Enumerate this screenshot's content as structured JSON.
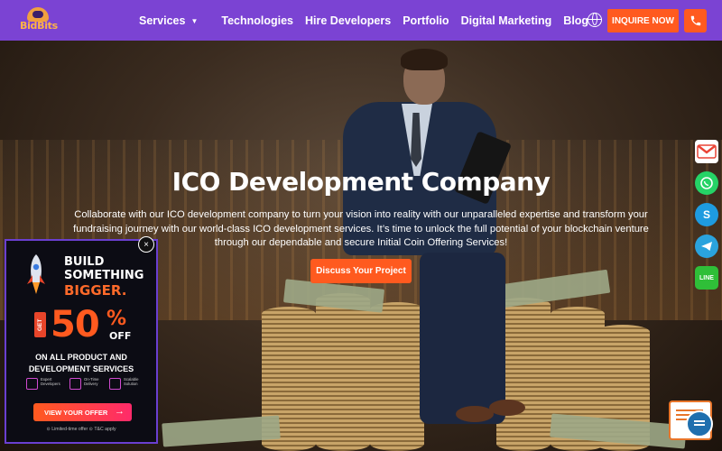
{
  "header": {
    "logo_text": "BidBits",
    "nav": [
      {
        "label": "Services",
        "has_dropdown": true
      },
      {
        "label": "Technologies"
      },
      {
        "label": "Hire Developers"
      },
      {
        "label": "Portfolio"
      },
      {
        "label": "Digital Marketing"
      },
      {
        "label": "Blog"
      }
    ],
    "inquire_label": "INQUIRE NOW",
    "icons": [
      "globe-icon",
      "phone-icon"
    ]
  },
  "hero": {
    "title": "ICO Development Company",
    "description": "Collaborate with our ICO development company to turn your vision into reality with our unparalleled expertise and transform your fundraising journey with our world-class ICO development services. It’s time to unlock the full potential of your blockchain venture through our dependable and secure Initial Coin Offering Services!",
    "cta_label": "Discuss Your Project"
  },
  "social": [
    {
      "name": "gmail-icon",
      "color": "#ea4335"
    },
    {
      "name": "whatsapp-icon",
      "color": "#25d366"
    },
    {
      "name": "skype-icon",
      "color": "#1e9be0"
    },
    {
      "name": "telegram-icon",
      "color": "#2aa3dd"
    },
    {
      "name": "line-icon",
      "color": "#2fbf38"
    }
  ],
  "promo": {
    "line1": "BUILD",
    "line2": "SOMETHING",
    "line3": "BIGGER.",
    "get": "GET",
    "percent_number": "50",
    "percent_sign": "%",
    "off": "OFF",
    "subtitle": "ON ALL PRODUCT AND DEVELOPMENT SERVICES",
    "features": [
      {
        "label": "Expert Developers"
      },
      {
        "label": "On-Time Delivery"
      },
      {
        "label": "Scalable Solution"
      }
    ],
    "offer_button": "VIEW YOUR OFFER",
    "footer": "⊙ Limited-time offer   ⊙ T&C apply",
    "close_glyph": "×"
  },
  "colors": {
    "header_bg": "#7b43d3",
    "accent": "#ff5a1f"
  }
}
